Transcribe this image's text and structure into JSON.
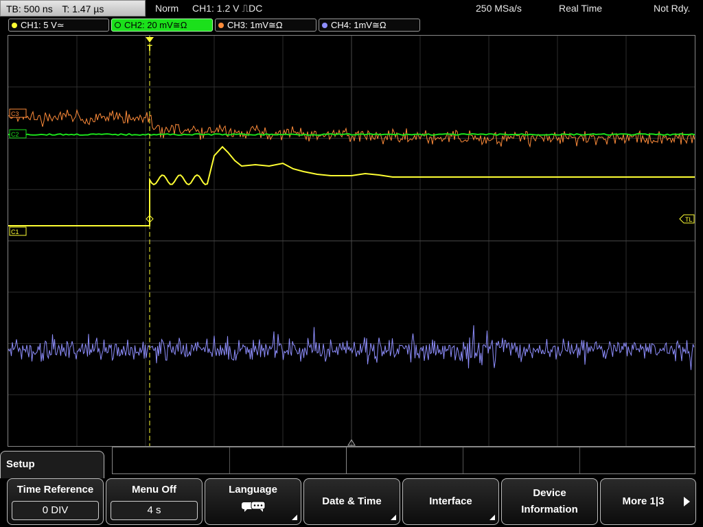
{
  "status": {
    "timebase": "TB: 500 ns",
    "trigger_time": "T: 1.47 µs",
    "mode": "Norm",
    "trigger_source": "CH1: 1.2 V ⎍DC",
    "sample_rate": "250 MSa/s",
    "acquisition": "Real Time",
    "state": "Not Rdy."
  },
  "channels": [
    {
      "label": "CH1: 5 V≃",
      "color": "#ffff33"
    },
    {
      "label": "CH2: 20 mV≅Ω",
      "color": "#1be01b",
      "active": true
    },
    {
      "label": "CH3: 1mV≅Ω",
      "color": "#ff8c3a"
    },
    {
      "label": "CH4: 1mV≅Ω",
      "color": "#8f8fff"
    }
  ],
  "markers": {
    "trigger": "T",
    "ch1": "C1",
    "ch2": "C2",
    "ch3": "C3",
    "trigger_level": "TL"
  },
  "menu": {
    "title": "Setup",
    "softkeys": [
      {
        "label": "Time Reference",
        "value": "0 DIV"
      },
      {
        "label": "Menu Off",
        "value": "4 s"
      },
      {
        "label": "Language",
        "icon": "speech-bubbles-icon"
      },
      {
        "label": "Date & Time"
      },
      {
        "label": "Interface"
      },
      {
        "label": "Device Information"
      },
      {
        "label": "More 1|3"
      }
    ]
  }
}
